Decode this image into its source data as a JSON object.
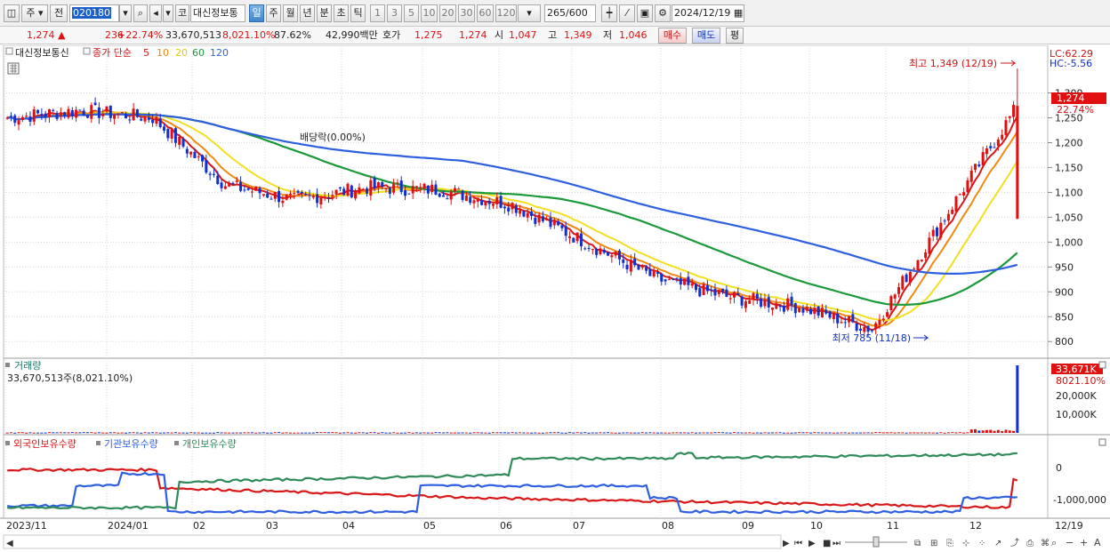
{
  "toolbar": {
    "market_type": "주",
    "prev_label": "전",
    "stock_code": "020180",
    "stock_name_prefix": "코",
    "stock_name": "대신정보통",
    "periods": [
      "일",
      "주",
      "월",
      "년",
      "분",
      "초",
      "틱"
    ],
    "active_period": "일",
    "intervals": [
      "1",
      "3",
      "5",
      "10",
      "20",
      "30",
      "60",
      "120"
    ],
    "count": "265",
    "count_total": "/600",
    "date": "2024/12/19"
  },
  "quote": {
    "price": "1,274",
    "change": "236",
    "change_pct": "+22.74%",
    "volume": "33,670,513",
    "volume_ratio": "8,021.10%",
    "turnover_pct": "87.62%",
    "amount": "42,990백만",
    "bid_label": "호가",
    "bid": "1,275",
    "ask": "1,274",
    "open_label": "시",
    "open": "1,047",
    "high_label": "고",
    "high": "1,349",
    "low_label": "저",
    "low": "1,046",
    "buy_button": "매수",
    "sell_button": "매도",
    "eval_button": "평"
  },
  "price_panel": {
    "stock_label": "대신정보통신",
    "ma_label": "종가 단순",
    "ma_periods": [
      "5",
      "10",
      "20",
      "60",
      "120"
    ],
    "lc": "LC:62.29",
    "hc": "HC:-5.56",
    "current_price": "1,274",
    "current_pct": "22.74%",
    "high_annotation": "최고 1,349 (12/19)",
    "low_annotation": "최저 785 (11/18)",
    "dividend_annotation": "배당락(0.00%)",
    "y_ticks": [
      "1,300",
      "1,250",
      "1,200",
      "1,150",
      "1,100",
      "1,050",
      "1,000",
      "950",
      "900",
      "850",
      "800"
    ]
  },
  "volume_panel": {
    "title": "거래량",
    "value_text": "33,670,513주(8,021.10%)",
    "badge": "33,671K",
    "badge_pct": "8021.10%",
    "y_ticks": [
      "20,000K",
      "10,000K"
    ]
  },
  "holdings_panel": {
    "legend": [
      "외국인보유수량",
      "기관보유수량",
      "개인보유수량"
    ],
    "y_ticks": [
      "0",
      "-1,000,000"
    ]
  },
  "x_axis": {
    "labels": [
      "2023/11",
      "2024/01",
      "02",
      "03",
      "04",
      "05",
      "06",
      "07",
      "08",
      "09",
      "10",
      "11",
      "12"
    ],
    "right_date": "12/19"
  },
  "colors": {
    "up": "#e01010",
    "down": "#1030d0",
    "ma5": "#d81818",
    "ma10": "#f08a10",
    "ma20": "#f2e020",
    "ma60": "#1a9a3a",
    "ma120": "#2e5fe0",
    "foreign": "#d81818",
    "institution": "#2e5fe0",
    "individual": "#2e8b57"
  },
  "chart_data": {
    "type": "candlestick",
    "title": "대신정보통신",
    "ylim": [
      770,
      1360
    ],
    "monthly_closes": [
      {
        "month": "2023/11",
        "close": 1250
      },
      {
        "month": "2023/12",
        "close": 1265
      },
      {
        "month": "2024/01",
        "close": 1250
      },
      {
        "month": "2024/02",
        "close": 1115
      },
      {
        "month": "2024/03",
        "close": 1085
      },
      {
        "month": "2024/04",
        "close": 1110
      },
      {
        "month": "2024/05",
        "close": 1105
      },
      {
        "month": "2024/06",
        "close": 1075
      },
      {
        "month": "2024/07",
        "close": 1000
      },
      {
        "month": "2024/08",
        "close": 925
      },
      {
        "month": "2024/09",
        "close": 890
      },
      {
        "month": "2024/10",
        "close": 870
      },
      {
        "month": "2024/11",
        "close": 825
      },
      {
        "month": "2024/12",
        "close": 1274
      }
    ],
    "last_candle": {
      "date": "2024/12/19",
      "open": 1047,
      "high": 1349,
      "low": 1046,
      "close": 1274
    },
    "period_high": {
      "date": "12/19",
      "value": 1349
    },
    "period_low": {
      "date": "11/18",
      "value": 785
    },
    "last_volume": 33670513
  }
}
